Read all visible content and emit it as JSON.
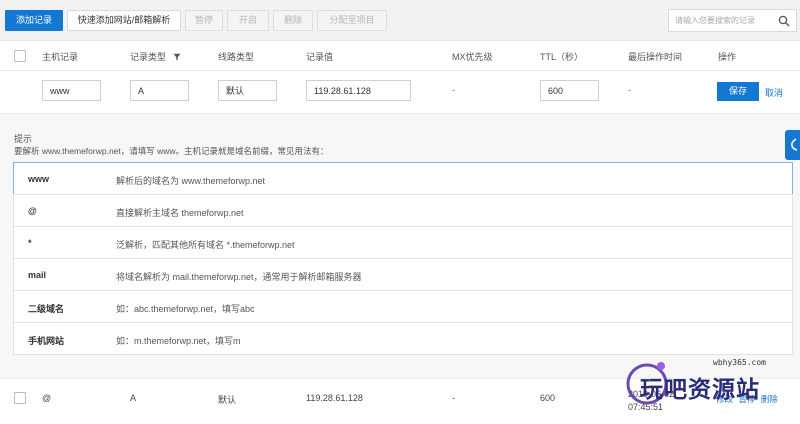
{
  "toolbar": {
    "add_record": "添加记录",
    "quick_add": "快速添加网站/邮箱解析",
    "pause": "暂停",
    "enable": "开启",
    "delete": "删除",
    "assign_project": "分配至项目",
    "search_placeholder": "请输入您要搜索的记录"
  },
  "table": {
    "headers": {
      "host": "主机记录",
      "type": "记录类型",
      "line": "线路类型",
      "value": "记录值",
      "mx": "MX优先级",
      "ttl": "TTL（秒）",
      "last_op": "最后操作时间",
      "actions": "操作"
    }
  },
  "edit_row": {
    "host": "www",
    "type": "A",
    "line": "默认",
    "value": "119.28.61.128",
    "mx": "-",
    "ttl": "600",
    "last_op": "-",
    "save": "保存",
    "cancel": "取消"
  },
  "tips": {
    "title": "提示",
    "description": "要解析 www.themeforwp.net，请填写 www。主机记录就是域名前缀，常见用法有：",
    "rows": [
      {
        "key": "www",
        "desc": "解析后的域名为 www.themeforwp.net"
      },
      {
        "key": "@",
        "desc": "直接解析主域名 themeforwp.net"
      },
      {
        "key": "*",
        "desc": "泛解析，匹配其他所有域名 *.themeforwp.net"
      },
      {
        "key": "mail",
        "desc": "将域名解析为 mail.themeforwp.net，通常用于解析邮箱服务器"
      },
      {
        "key": "二级域名",
        "desc": "如：abc.themeforwp.net，填写abc"
      },
      {
        "key": "手机网站",
        "desc": "如：m.themeforwp.net，填写m"
      }
    ]
  },
  "data_row": {
    "host": "@",
    "type": "A",
    "line": "默认",
    "value": "119.28.61.128",
    "mx": "-",
    "ttl": "600",
    "last_op_date": "2019-06-02",
    "last_op_time": "07:45:51",
    "actions": [
      "修改",
      "暂停",
      "删除"
    ]
  },
  "watermark": {
    "url": "wbhy365.com",
    "text": "玩吧资源站"
  },
  "colors": {
    "primary": "#1478d2",
    "tips_bg": "#f7f7f7",
    "watermark": "#2a2a7a"
  },
  "icons": {
    "search": "search-icon",
    "filter": "filter-icon",
    "side_tab": "feedback-icon"
  }
}
